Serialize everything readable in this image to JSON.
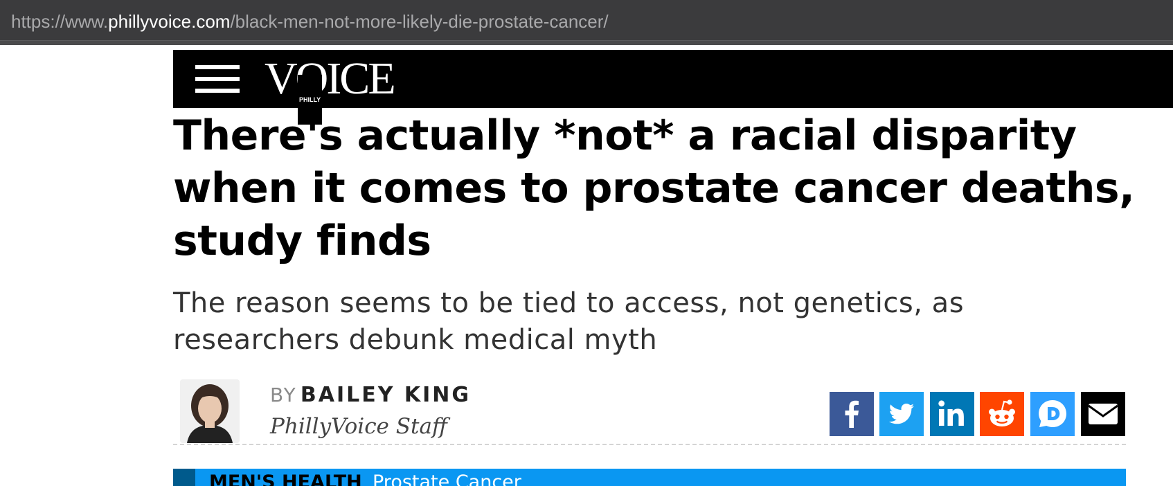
{
  "browser": {
    "url_prefix": "https://www.",
    "url_host": "phillyvoice.com",
    "url_path": "/black-men-not-more-likely-die-prostate-cancer/"
  },
  "header": {
    "menu_icon": "hamburger-menu-icon",
    "logo_text": "VOICE",
    "logo_small_text": "PHILLY"
  },
  "article": {
    "headline": "There's actually *not* a racial disparity when it comes to prostate cancer deaths, study finds",
    "subheadline": "The reason seems to be tied to access, not genetics, as researchers debunk medical myth",
    "byline_prefix": "BY",
    "author_name": "BAILEY KING",
    "author_role": "PhillyVoice Staff"
  },
  "share": [
    {
      "name": "facebook-icon",
      "color": "#3b5998"
    },
    {
      "name": "twitter-icon",
      "color": "#1da1f2"
    },
    {
      "name": "linkedin-icon",
      "color": "#0077b5"
    },
    {
      "name": "reddit-icon",
      "color": "#ff4500"
    },
    {
      "name": "disqus-icon",
      "color": "#2e9fff"
    },
    {
      "name": "email-icon",
      "color": "#000000"
    }
  ],
  "topics": {
    "primary": "MEN'S HEALTH",
    "secondary": "Prostate Cancer"
  },
  "colors": {
    "topic_bar": "#0a97f2",
    "header_bg": "#000000"
  }
}
